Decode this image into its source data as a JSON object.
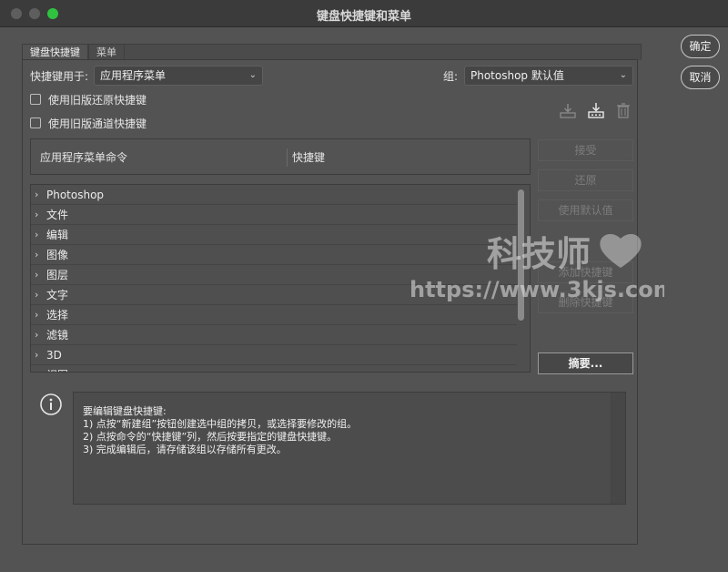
{
  "window": {
    "title": "键盘快捷键和菜单"
  },
  "dialog_buttons": {
    "ok": "确定",
    "cancel": "取消"
  },
  "tabs": [
    {
      "label": "键盘快捷键",
      "active": true
    },
    {
      "label": "菜单",
      "active": false
    }
  ],
  "shortcuts_for": {
    "label": "快捷键用于:",
    "value": "应用程序菜单"
  },
  "group": {
    "label": "组:",
    "value": "Photoshop 默认值"
  },
  "checkboxes": [
    {
      "label": "使用旧版还原快捷键",
      "checked": false
    },
    {
      "label": "使用旧版通道快捷键",
      "checked": false
    }
  ],
  "table": {
    "col_command": "应用程序菜单命令",
    "col_shortcut": "快捷键",
    "rows": [
      "Photoshop",
      "文件",
      "编辑",
      "图像",
      "图层",
      "文字",
      "选择",
      "滤镜",
      "3D",
      "视图"
    ]
  },
  "right_buttons": {
    "accept": "接受",
    "undo": "还原",
    "use_default": "使用默认值",
    "add_shortcut": "添加快捷键",
    "delete_shortcut": "删除快捷键",
    "summary": "摘要..."
  },
  "info": {
    "lines": [
      "要编辑键盘快捷键:",
      "1) 点按“新建组”按钮创建选中组的拷贝，或选择要修改的组。",
      "2) 点按命令的“快捷键”列，然后按要指定的键盘快捷键。",
      "3) 完成编辑后，请存储该组以存储所有更改。"
    ]
  },
  "watermark": {
    "line1": "科技师",
    "line2": "https://www.3kjs.com"
  },
  "colors": {
    "background": "#535353",
    "titlebar": "#3b3b3b",
    "max_button": "#2fc340"
  }
}
